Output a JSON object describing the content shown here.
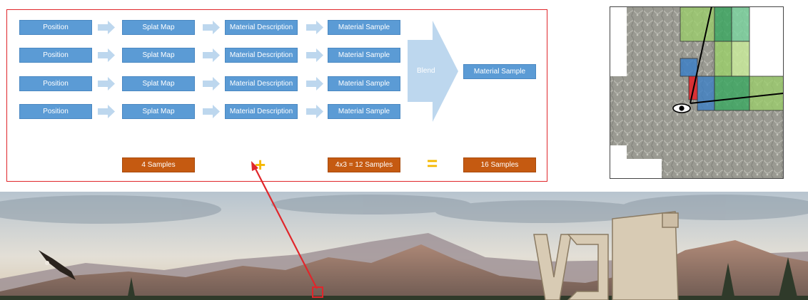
{
  "diagram": {
    "rows": [
      {
        "position": "Position",
        "splat": "Splat Map",
        "desc": "Material Description",
        "sample": "Material Sample"
      },
      {
        "position": "Position",
        "splat": "Splat Map",
        "desc": "Material Description",
        "sample": "Material Sample"
      },
      {
        "position": "Position",
        "splat": "Splat Map",
        "desc": "Material Description",
        "sample": "Material Sample"
      },
      {
        "position": "Position",
        "splat": "Splat Map",
        "desc": "Material Description",
        "sample": "Material Sample"
      }
    ],
    "blend_label": "Blend",
    "output_label": "Material Sample",
    "sum": {
      "left": "4 Samples",
      "plus": "+",
      "middle": "4x3 = 12 Samples",
      "equals": "=",
      "total": "16 Samples"
    }
  },
  "colors": {
    "box_blue": "#5b9bd5",
    "arrow_light_blue": "#bdd7ee",
    "orange": "#c55a11",
    "symbol_yellow": "#f5b800",
    "highlight_red": "#e0262b"
  },
  "icons": {
    "camera_eye": "eye-icon"
  }
}
